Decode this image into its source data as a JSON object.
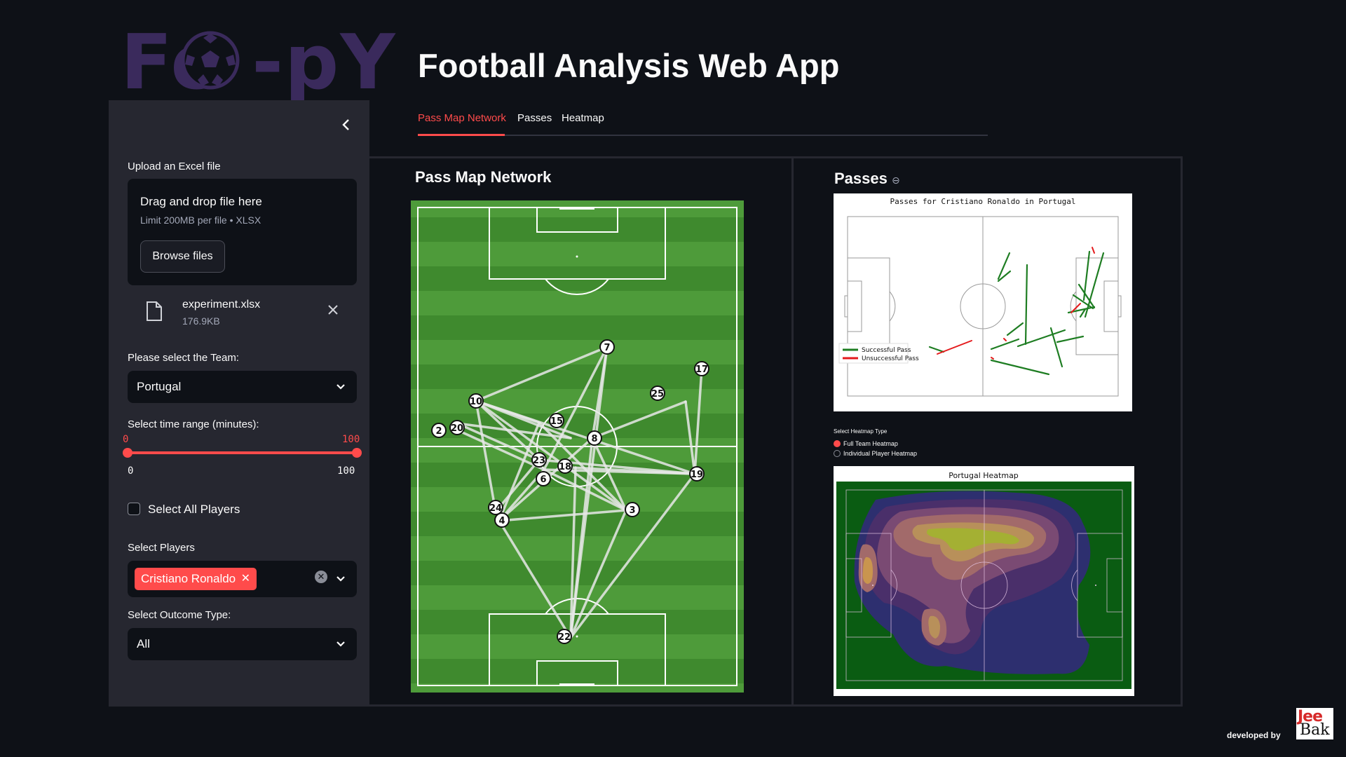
{
  "logo": {
    "text": "Fo  -pY"
  },
  "sidebar": {
    "collapse_icon": "chevron-left-icon",
    "upload_label": "Upload an Excel file",
    "dropzone_title": "Drag and drop file here",
    "dropzone_sub": "Limit 200MB per file • XLSX",
    "browse_label": "Browse files",
    "file_name": "experiment.xlsx",
    "file_size": "176.9KB",
    "team_label": "Please select the Team:",
    "team_value": "Portugal",
    "time_label": "Select time range (minutes):",
    "time_min": "0",
    "time_max": "100",
    "time_sel_min": "0",
    "time_sel_max": "100",
    "select_all_label": "Select All Players",
    "players_label": "Select Players",
    "player_tag": "Cristiano Ronaldo",
    "outcome_label": "Select Outcome Type:",
    "outcome_value": "All"
  },
  "main": {
    "title": "Football Analysis Web App",
    "tabs": [
      {
        "label": "Pass Map Network"
      },
      {
        "label": "Passes"
      },
      {
        "label": "Heatmap"
      }
    ],
    "left_heading": "Pass Map Network",
    "right_heading": "Passes"
  },
  "pass_network": {
    "players": [
      "7",
      "17",
      "10",
      "25",
      "2",
      "20",
      "15",
      "8",
      "23",
      "18",
      "19",
      "6",
      "24",
      "4",
      "3",
      "22"
    ]
  },
  "passes_chart": {
    "title": "Passes for Cristiano Ronaldo   in Portugal",
    "legend_success": "Successful Pass",
    "legend_fail": "Unsuccessful Pass",
    "success_color": "#1e7d22",
    "fail_color": "#e41a1c"
  },
  "heatmap": {
    "type_label": "Select Heatmap Type",
    "option_full": "Full Team Heatmap",
    "option_individual": "Individual Player Heatmap",
    "title": "Portugal Heatmap"
  },
  "footer": {
    "credit": "developed by",
    "brand_top": "Jee",
    "brand_bottom": "Bak"
  }
}
